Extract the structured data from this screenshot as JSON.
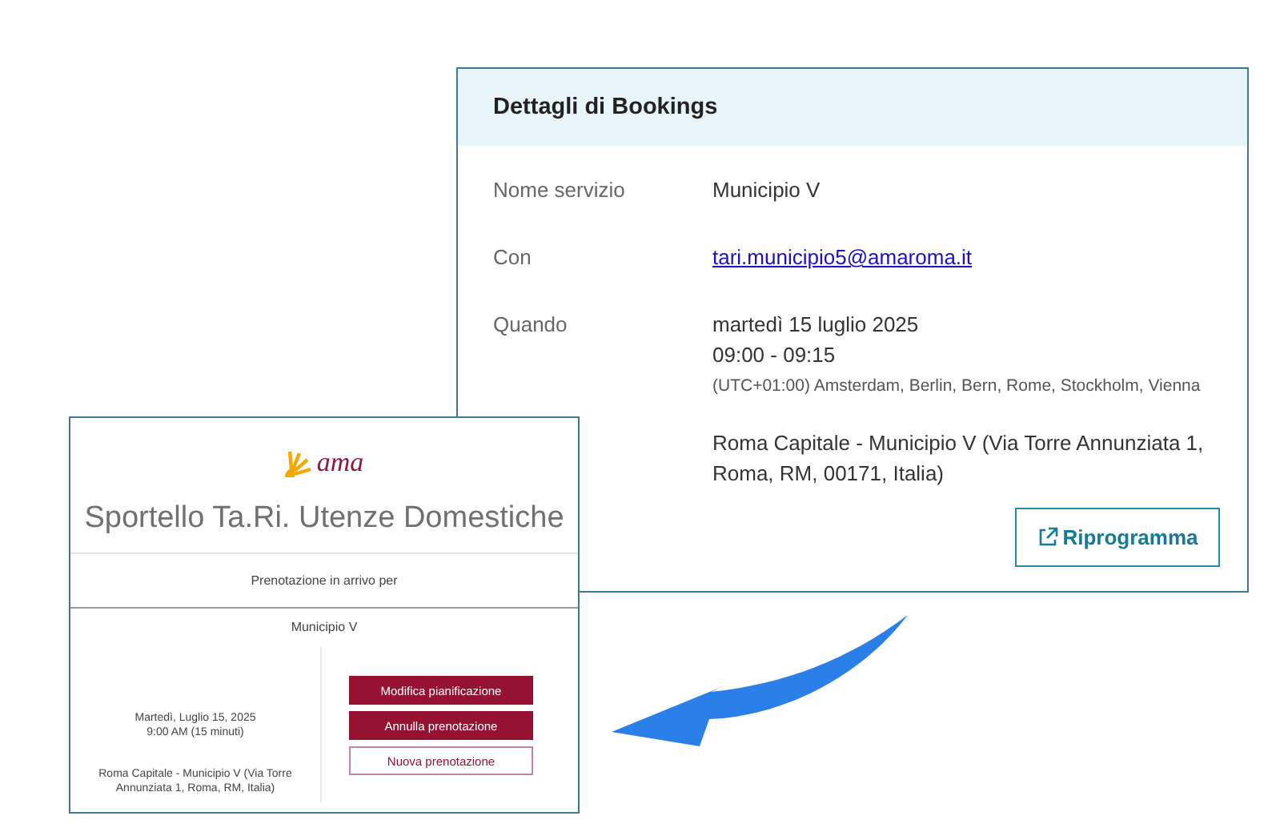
{
  "details": {
    "title": "Dettagli di Bookings",
    "rows": [
      {
        "label": "Nome servizio",
        "values": [
          {
            "kind": "text",
            "text": "Municipio V"
          }
        ]
      },
      {
        "label": "Con",
        "values": [
          {
            "kind": "link",
            "text": "tari.municipio5@amaroma.it"
          }
        ]
      },
      {
        "label": "Quando",
        "values": [
          {
            "kind": "text",
            "text": "martedì 15 luglio 2025"
          },
          {
            "kind": "text",
            "text": "09:00 - 09:15"
          },
          {
            "kind": "note",
            "text": "(UTC+01:00) Amsterdam, Berlin, Bern, Rome, Stockholm, Vienna"
          }
        ]
      },
      {
        "values": [
          {
            "kind": "text",
            "text": "Roma Capitale - Municipio V (Via Torre Annunziata 1, Roma, RM, 00171, Italia)"
          }
        ]
      }
    ],
    "button": "Riprogramma"
  },
  "card": {
    "logo": "ama",
    "title": "Sportello Ta.Ri. Utenze Domestiche",
    "subtitle": "Prenotazione in arrivo per",
    "service": "Municipio V",
    "when": [
      "Martedì, Luglio 15, 2025",
      "9:00 AM (15 minuti)"
    ],
    "address": "Roma Capitale - Municipio V (Via Torre Annunziata 1, Roma, RM, Italia)",
    "buttons": [
      {
        "kind": "primary",
        "label": "Modifica pianificazione"
      },
      {
        "kind": "primary",
        "label": "Annulla prenotazione"
      },
      {
        "kind": "secondary",
        "label": "Nuova prenotazione"
      }
    ]
  }
}
